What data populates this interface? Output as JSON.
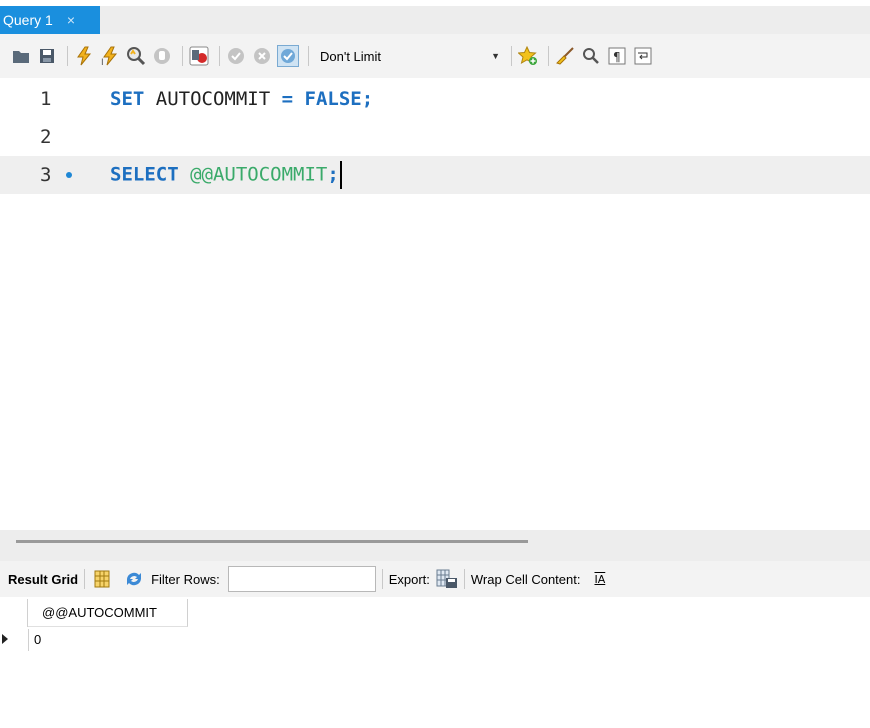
{
  "tabs": [
    {
      "label": "Query 1",
      "close": "×"
    }
  ],
  "toolbar": {
    "limit_select_value": "Don't Limit",
    "icons": [
      "open-folder-icon",
      "save-icon",
      "execute-icon",
      "execute-current-icon",
      "explain-icon",
      "stop-icon",
      "toggle-error-icon",
      "commit-icon",
      "rollback-icon",
      "autocommit-icon",
      "add-snippet-icon",
      "beautify-icon",
      "find-icon",
      "invisible-chars-icon",
      "wrap-icon"
    ]
  },
  "editor": {
    "lines": [
      {
        "number": "1",
        "parts": [
          {
            "t": "SET",
            "c": "kw"
          },
          {
            "t": " AUTOCOMMIT ",
            "c": "plain"
          },
          {
            "t": "=",
            "c": "kw"
          },
          {
            "t": " ",
            "c": "plain"
          },
          {
            "t": "FALSE",
            "c": "kw"
          },
          {
            "t": ";",
            "c": "kw"
          }
        ]
      },
      {
        "number": "2",
        "parts": []
      },
      {
        "number": "3",
        "parts": [
          {
            "t": "SELECT",
            "c": "kw"
          },
          {
            "t": " ",
            "c": "plain"
          },
          {
            "t": "@@AUTOCOMMIT",
            "c": "var"
          },
          {
            "t": ";",
            "c": "kw"
          }
        ]
      }
    ]
  },
  "result_toolbar": {
    "result_grid_label": "Result Grid",
    "filter_rows_label": "Filter Rows:",
    "filter_rows_value": "",
    "export_label": "Export:",
    "wrap_label": "Wrap Cell Content:",
    "wrap_icon_text": "IA"
  },
  "grid": {
    "columns": [
      "@@AUTOCOMMIT"
    ],
    "rows": [
      [
        "0"
      ]
    ]
  }
}
